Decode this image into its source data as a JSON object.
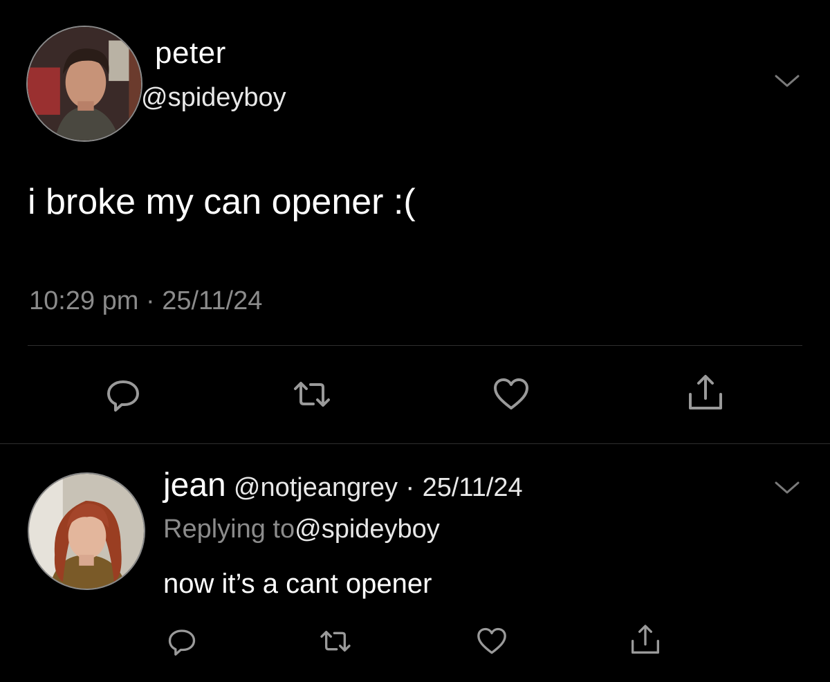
{
  "main_tweet": {
    "display_name": "peter",
    "handle": "@spideyboy",
    "text": "i broke my can opener :(",
    "time": "10:29 pm",
    "separator": " · ",
    "date": "25/11/24",
    "icons": {
      "avatar": "avatar-photo",
      "menu": "chevron-down-icon",
      "reply": "reply-bubble-icon",
      "retweet": "retweet-icon",
      "like": "heart-icon",
      "share": "share-icon"
    }
  },
  "reply_tweet": {
    "display_name": "jean",
    "handle": "@notjeangrey",
    "separator": " · ",
    "date": "25/11/24",
    "replying_label": "Replying to",
    "replying_handle": "@spideyboy",
    "text": "now it’s a cant opener",
    "icons": {
      "avatar": "avatar-photo",
      "menu": "chevron-down-icon",
      "reply": "reply-bubble-icon",
      "retweet": "retweet-icon",
      "like": "heart-icon",
      "share": "share-icon"
    }
  },
  "colors": {
    "background": "#000000",
    "primary_text": "#ffffff",
    "secondary_text": "#8b8b8b",
    "icon_gray": "#9a9a9a",
    "divider": "#2f2f2f"
  }
}
